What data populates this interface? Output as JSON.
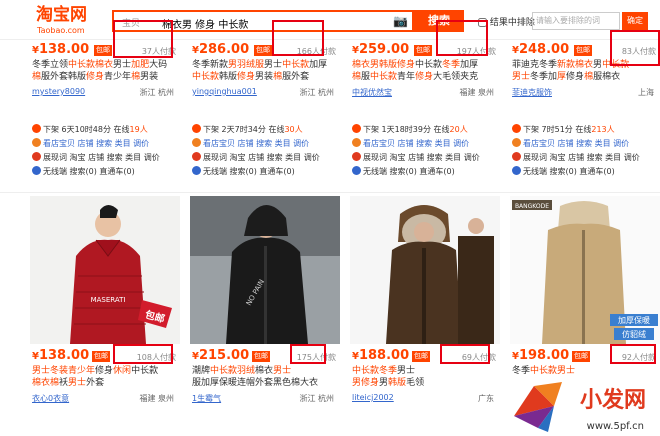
{
  "header": {
    "logo": "淘宝网",
    "logo_sub": "Taobao.com",
    "search_placeholder": "宝贝",
    "search_query": "棉衣男 修身 中长款",
    "search_button": "搜索",
    "exclude_label": "结果中排除",
    "shop_placeholder": "请输入要排除的词",
    "confirm": "确定"
  },
  "row1": [
    {
      "price": "138.00",
      "paid": "37人付款",
      "t1": "冬季立领",
      "t1b": "中长款",
      "t1c": "棉衣",
      "t1d": "男士",
      "t1e": "加肥",
      "t1f": "大码",
      "t2b": "棉",
      "t2": "服外套韩版",
      "t2c": "修身",
      "t2d": "青少年",
      "t2e": "棉",
      "t2f": "男装",
      "shop": "mystery8090",
      "loc": "浙江 杭州",
      "l1": "下架 6天10时48分 在线",
      "l1n": "19人",
      "l2": "看店宝贝 店铺 搜索 类目 调价",
      "l3": "展现词 淘宝 店铺 搜索 类目 调价",
      "l4": "无线端 搜索(0) 直通车(0)"
    },
    {
      "price": "286.00",
      "paid": "166人付款",
      "t1": "冬季新款",
      "t1b": "男",
      "t1c": "羽绒服",
      "t1d": "男士",
      "t1e": "中长款",
      "t1f": "加厚",
      "t2b": "中长款",
      "t2": "韩版",
      "t2c": "修身",
      "t2d": "男装",
      "t2e": "棉",
      "t2f": "服外套",
      "shop": "yingqinghua001",
      "loc": "浙江 杭州",
      "l1": "下架 2天7时34分 在线",
      "l1n": "30人",
      "l2": "看店宝贝 店铺 搜索 类目 调价",
      "l3": "展现词 淘宝 店铺 搜索 类目 调价",
      "l4": "无线端 搜索(0) 直通车(0)"
    },
    {
      "price": "259.00",
      "paid": "197人付款",
      "t1": "",
      "t1b": "棉衣男",
      "t1c": "韩版修身",
      "t1d": "中长款",
      "t1e": "冬季",
      "t1f": "加厚",
      "t2b": "棉",
      "t2": "服",
      "t2c": "中长款",
      "t2d": "青年",
      "t2e": "修身",
      "t2f": "大毛领夹克",
      "shop": "中视优然宝",
      "loc": "福建 泉州",
      "l1": "下架 1天18时39分 在线",
      "l1n": "20人",
      "l2": "看店宝贝 店铺 搜索 类目 调价",
      "l3": "展现词 淘宝 店铺 搜索 类目 调价",
      "l4": "无线端 搜索(0) 直通车(0)"
    },
    {
      "price": "248.00",
      "paid": "83人付款",
      "t1": "菲迪克冬季",
      "t1b": "新款",
      "t1c": "棉衣",
      "t1d": "男",
      "t1e": "中长款",
      "t1f": "",
      "t2b": "男士",
      "t2": "冬季加",
      "t2c": "厚",
      "t2d": "修身",
      "t2e": "棉",
      "t2f": "服棉衣",
      "shop": "菲迪克服饰",
      "loc": "上海",
      "l1": "下架 7时51分 在线",
      "l1n": "213人",
      "l2": "看店宝贝 店铺 搜索 类目 调价",
      "l3": "展现词 淘宝 店铺 搜索 类目 调价",
      "l4": "无线端 搜索(0) 直通车(0)"
    }
  ],
  "row2": [
    {
      "price": "138.00",
      "paid": "108人付款",
      "t1": "",
      "t1b": "男士",
      "t1c": "冬装青少年",
      "t1d": "修身",
      "t1e": "休闲",
      "t1f": "中长款",
      "t2b": "棉衣",
      "t2": "",
      "t2c": "棉",
      "t2d": "袄",
      "t2e": "男士",
      "t2f": "外套",
      "shop": "衣心0衣意",
      "loc": "福建 泉州"
    },
    {
      "price": "215.00",
      "paid": "175人付款",
      "t1": "潮牌",
      "t1b": "中长款",
      "t1c": "羽绒",
      "t1d": "棉衣",
      "t1e": "男士",
      "t1f": "",
      "t2b": "",
      "t2": "服加厚保暖连帽外套黑色",
      "t2c": "",
      "t2d": "棉大衣",
      "t2e": "",
      "t2f": "",
      "shop": "1生霉气",
      "loc": "浙江 杭州"
    },
    {
      "price": "188.00",
      "paid": "69人付款",
      "t1": "",
      "t1b": "中长款",
      "t1c": "冬季",
      "t1d": "男士",
      "t1e": "",
      "t1f": "",
      "t2b": "男",
      "t2": "",
      "t2c": "修身",
      "t2d": "男",
      "t2e": "韩版",
      "t2f": "毛领",
      "shop": "liteicj2002",
      "loc": "广东",
      "l1": "",
      "l1n": "",
      "l2": "",
      "l3": "",
      "l4": ""
    },
    {
      "price": "198.00",
      "paid": "92人付款",
      "t1": "冬季",
      "t1b": "中长款",
      "t1c": "男士",
      "t1d": "",
      "t1e": "",
      "t1f": "",
      "t2b": "",
      "t2": "",
      "t2c": "",
      "t2d": "",
      "t2e": "",
      "t2f": "",
      "shop": "",
      "loc": "",
      "l1": "",
      "l1n": "",
      "l2": "",
      "l3": "",
      "l4": ""
    }
  ],
  "images": {
    "bag_text": "包邮",
    "logo_text": "MASERATI",
    "badge": "BANGKODE",
    "overlay": "加厚保暖",
    "overlay2": "仿貂绒"
  },
  "watermark": {
    "brand": "小发网",
    "url": "www.5pf.cn"
  }
}
